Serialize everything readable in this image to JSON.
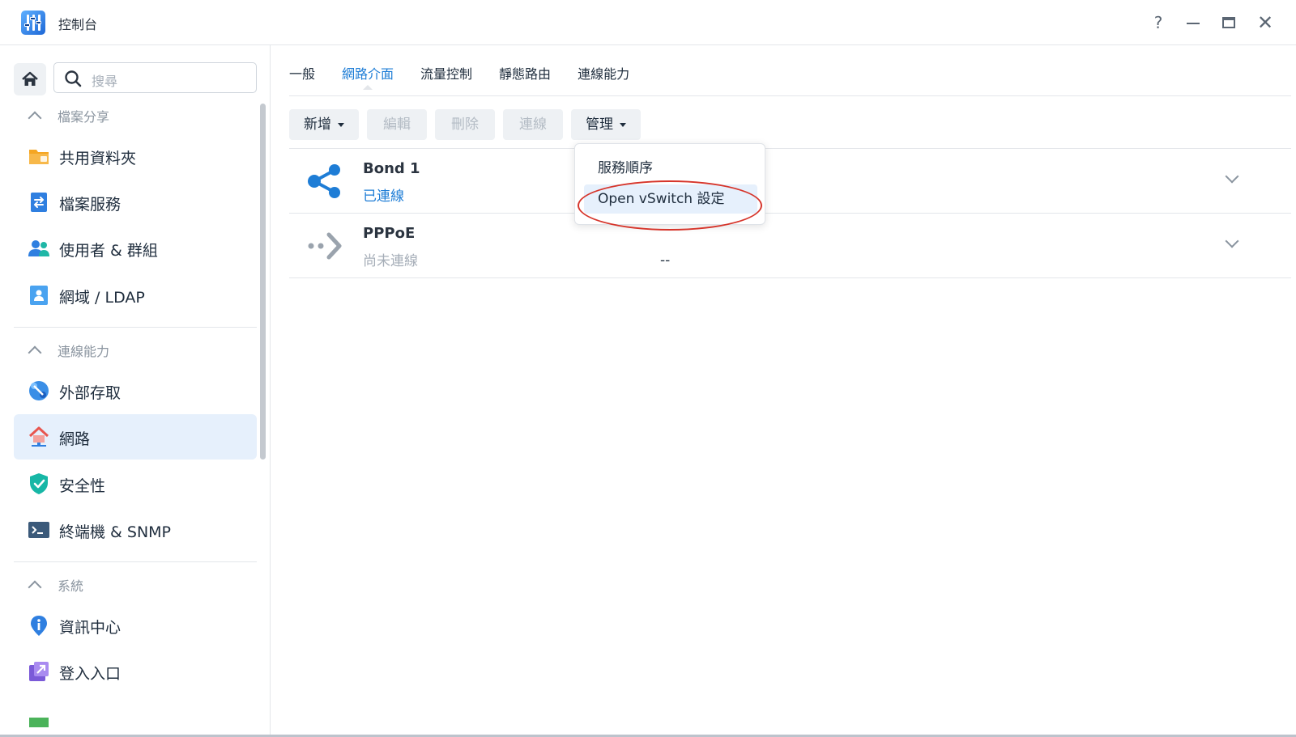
{
  "window": {
    "title": "控制台",
    "controls": {
      "help": "?",
      "close": "✕"
    }
  },
  "sidebar": {
    "search_placeholder": "搜尋",
    "sections": [
      {
        "label": "檔案分享",
        "items": [
          "共用資料夾",
          "檔案服務",
          "使用者 & 群組",
          "網域 / LDAP"
        ]
      },
      {
        "label": "連線能力",
        "items": [
          "外部存取",
          "網路",
          "安全性",
          "終端機 & SNMP"
        ]
      },
      {
        "label": "系統",
        "items": [
          "資訊中心",
          "登入入口"
        ]
      }
    ],
    "active_item": "網路"
  },
  "tabs": [
    "一般",
    "網路介面",
    "流量控制",
    "靜態路由",
    "連線能力"
  ],
  "active_tab": "網路介面",
  "toolbar": {
    "add": "新增",
    "edit": "編輯",
    "delete": "刪除",
    "connect": "連線",
    "manage": "管理"
  },
  "interfaces": [
    {
      "name": "Bond 1",
      "status": "已連線",
      "extra": ""
    },
    {
      "name": "PPPoE",
      "status": "尚未連線",
      "extra": "--"
    }
  ],
  "manage_menu": {
    "items": [
      "服務順序",
      "Open vSwitch 設定"
    ],
    "highlighted": "Open vSwitch 設定"
  },
  "colors": {
    "accent": "#1e7dd6",
    "annotation": "#d6352b",
    "active_bg": "#e6f0fc"
  }
}
